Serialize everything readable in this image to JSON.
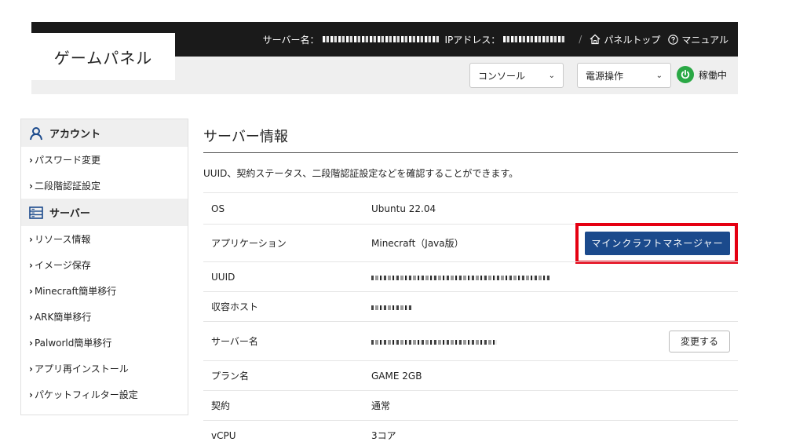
{
  "header": {
    "logo_text": "ゲームパネル",
    "server_name_label": "サーバー名：",
    "ip_label": "IPアドレス：",
    "separator": "/",
    "panel_top_label": "パネルトップ",
    "manual_label": "マニュアル"
  },
  "toolbar": {
    "console_select": "コンソール",
    "power_select": "電源操作",
    "status_label": "稼働中"
  },
  "sidebar": {
    "account_heading": "アカウント",
    "account_items": [
      "パスワード変更",
      "二段階認証設定"
    ],
    "server_heading": "サーバー",
    "server_items": [
      "リソース情報",
      "イメージ保存",
      "Minecraft簡単移行",
      "ARK簡単移行",
      "Palworld簡単移行",
      "アプリ再インストール",
      "パケットフィルター設定"
    ]
  },
  "main": {
    "title": "サーバー情報",
    "description": "UUID、契約ステータス、二段階認証設定などを確認することができます。",
    "rows": [
      {
        "key": "OS",
        "value": "Ubuntu 22.04"
      },
      {
        "key": "アプリケーション",
        "value": "Minecraft（Java版）"
      },
      {
        "key": "UUID",
        "value": ""
      },
      {
        "key": "収容ホスト",
        "value": ""
      },
      {
        "key": "サーバー名",
        "value": ""
      },
      {
        "key": "プラン名",
        "value": "GAME 2GB"
      },
      {
        "key": "契約",
        "value": "通常"
      },
      {
        "key": "vCPU",
        "value": "3コア"
      }
    ],
    "manager_button": "マインクラフトマネージャー",
    "change_button": "変更する"
  },
  "colors": {
    "topbar": "#1a1a1a",
    "accent_blue": "#1b4a8c",
    "highlight_red": "#e50012",
    "status_green": "#2aa845"
  }
}
